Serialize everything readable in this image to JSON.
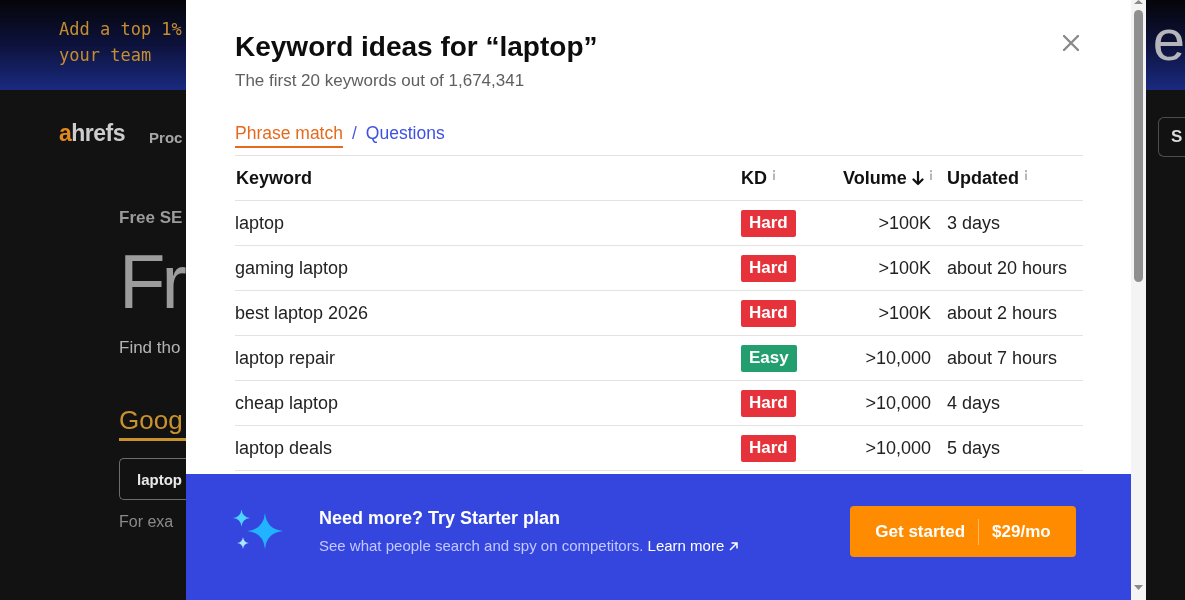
{
  "page": {
    "banner_lines": [
      "Add a top 1%",
      "your team"
    ],
    "banner_heading": "e",
    "logo": {
      "accent": "a",
      "text": "hrefs"
    },
    "nav_link": "Proc",
    "header_button": "S",
    "eyebrow": "Free SE",
    "headline": "Fr",
    "lead": "Find tho",
    "tool_tab": "Goog",
    "search_value": "laptop",
    "hint": "For exa"
  },
  "dialog": {
    "title": "Keyword ideas for “laptop”",
    "subtitle": "The first 20 keywords out of 1,674,341",
    "tabs": [
      {
        "label": "Phrase match",
        "selected": true
      },
      {
        "label": "Questions",
        "selected": false
      }
    ],
    "tab_separator": "/"
  },
  "table": {
    "columns": [
      {
        "label": "Keyword",
        "info": false,
        "sorted": false
      },
      {
        "label": "KD",
        "info": true,
        "sorted": false
      },
      {
        "label": "Volume",
        "info": true,
        "sorted": true
      },
      {
        "label": "Updated",
        "info": true,
        "sorted": false
      }
    ],
    "rows": [
      {
        "keyword": "laptop",
        "kd": {
          "label": "Hard",
          "color": "#e6333b"
        },
        "volume": ">100K",
        "updated": "3 days"
      },
      {
        "keyword": "gaming laptop",
        "kd": {
          "label": "Hard",
          "color": "#e6333b"
        },
        "volume": ">100K",
        "updated": "about 20 hours"
      },
      {
        "keyword": "best laptop 2026",
        "kd": {
          "label": "Hard",
          "color": "#e6333b"
        },
        "volume": ">100K",
        "updated": "about 2 hours"
      },
      {
        "keyword": "laptop repair",
        "kd": {
          "label": "Easy",
          "color": "#239f6f"
        },
        "volume": ">10,000",
        "updated": "about 7 hours"
      },
      {
        "keyword": "cheap laptop",
        "kd": {
          "label": "Hard",
          "color": "#e6333b"
        },
        "volume": ">10,000",
        "updated": "4 days"
      },
      {
        "keyword": "laptop deals",
        "kd": {
          "label": "Hard",
          "color": "#e6333b"
        },
        "volume": ">10,000",
        "updated": "5 days"
      }
    ]
  },
  "upgrade": {
    "title": "Need more? Try Starter plan",
    "description": "See what people search and spy on competitors.",
    "link": "Learn more",
    "button": {
      "label": "Get started",
      "price": "$29/mo"
    }
  }
}
